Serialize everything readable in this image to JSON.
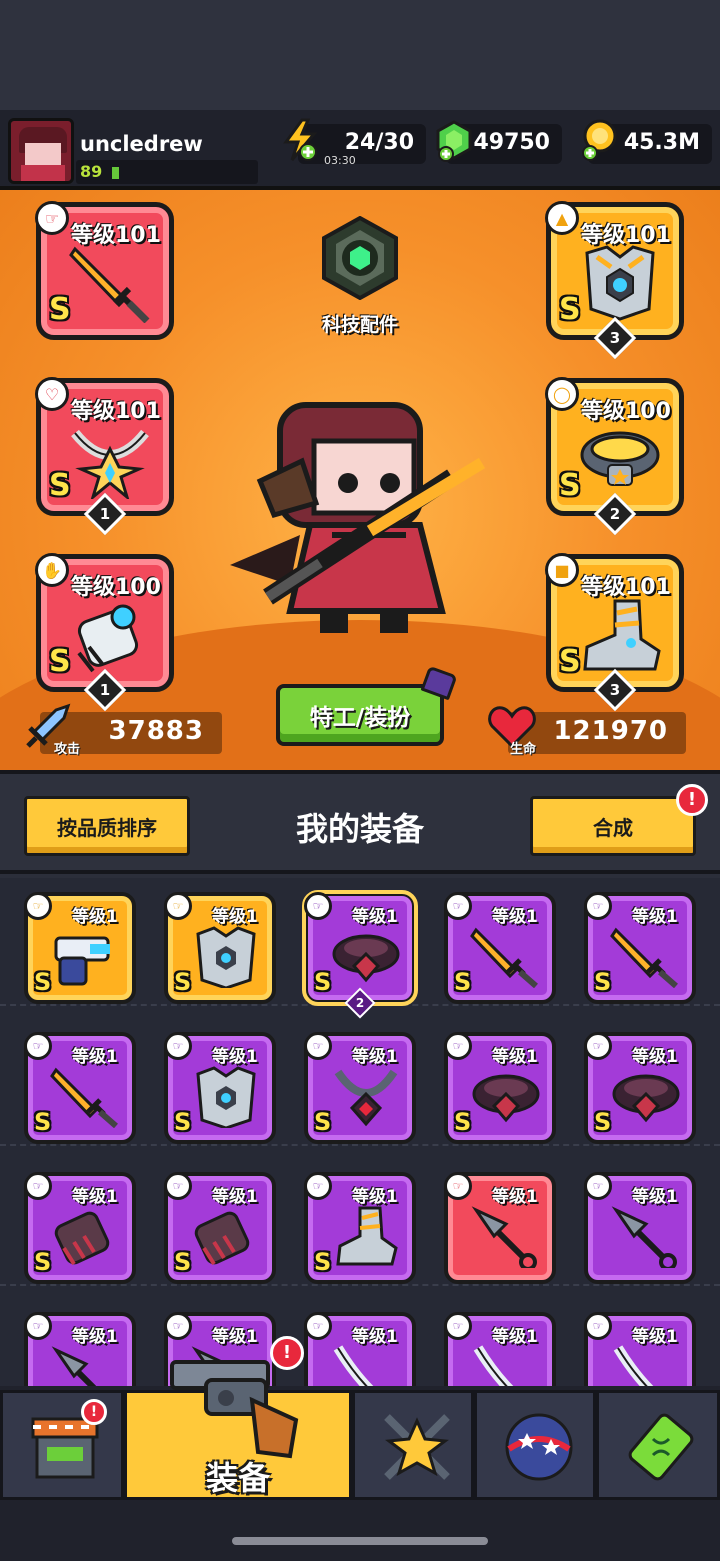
{
  "player": {
    "name": "uncledrew",
    "level": "89",
    "xp_fraction": 0.05
  },
  "resources": {
    "energy": {
      "value": "24/30",
      "timer": "03:30"
    },
    "gems": {
      "value": "49750"
    },
    "coins": {
      "value": "45.3M"
    }
  },
  "stage": {
    "tech_label": "科技配件",
    "costume_button": "特工/装扮",
    "attack": {
      "label": "攻击",
      "value": "37883"
    },
    "health": {
      "label": "生命",
      "value": "121970"
    }
  },
  "equipped": {
    "weapon": {
      "level": "等级101",
      "grade": "S",
      "stars": ""
    },
    "necklace": {
      "level": "等级101",
      "grade": "S",
      "stars": "1"
    },
    "glove": {
      "level": "等级100",
      "grade": "S",
      "stars": "1"
    },
    "armor": {
      "level": "等级101",
      "grade": "S",
      "stars": "3"
    },
    "belt": {
      "level": "等级100",
      "grade": "S",
      "stars": "2"
    },
    "boots": {
      "level": "等级101",
      "grade": "S",
      "stars": "3"
    }
  },
  "equipment_panel": {
    "sort_button": "按品质排序",
    "title": "我的装备",
    "merge_button": "合成",
    "alert": "!"
  },
  "inventory": [
    {
      "level": "等级1",
      "grade": "S",
      "rarity": "gold",
      "icon": "gun-icon",
      "stars": ""
    },
    {
      "level": "等级1",
      "grade": "S",
      "rarity": "gold",
      "icon": "armor-icon",
      "stars": ""
    },
    {
      "level": "等级1",
      "grade": "S",
      "rarity": "purple",
      "icon": "belt-icon",
      "stars": "2"
    },
    {
      "level": "等级1",
      "grade": "S",
      "rarity": "purple",
      "icon": "sword-icon",
      "stars": ""
    },
    {
      "level": "等级1",
      "grade": "S",
      "rarity": "purple",
      "icon": "sword-icon",
      "stars": ""
    },
    {
      "level": "等级1",
      "grade": "S",
      "rarity": "purple",
      "icon": "sword-icon",
      "stars": ""
    },
    {
      "level": "等级1",
      "grade": "S",
      "rarity": "purple",
      "icon": "armor-icon",
      "stars": ""
    },
    {
      "level": "等级1",
      "grade": "S",
      "rarity": "purple",
      "icon": "necklace-icon",
      "stars": ""
    },
    {
      "level": "等级1",
      "grade": "S",
      "rarity": "purple",
      "icon": "belt-icon",
      "stars": ""
    },
    {
      "level": "等级1",
      "grade": "S",
      "rarity": "purple",
      "icon": "belt-icon",
      "stars": ""
    },
    {
      "level": "等级1",
      "grade": "S",
      "rarity": "purple",
      "icon": "glove-icon",
      "stars": ""
    },
    {
      "level": "等级1",
      "grade": "S",
      "rarity": "purple",
      "icon": "glove-icon",
      "stars": ""
    },
    {
      "level": "等级1",
      "grade": "S",
      "rarity": "purple",
      "icon": "boots-icon",
      "stars": ""
    },
    {
      "level": "等级1",
      "grade": "",
      "rarity": "red",
      "icon": "kunai-icon",
      "stars": ""
    },
    {
      "level": "等级1",
      "grade": "",
      "rarity": "purple",
      "icon": "kunai-icon",
      "stars": ""
    },
    {
      "level": "等级1",
      "grade": "",
      "rarity": "purple",
      "icon": "kunai-icon",
      "stars": ""
    },
    {
      "level": "等级1",
      "grade": "",
      "rarity": "purple",
      "icon": "kunai-icon",
      "stars": ""
    },
    {
      "level": "等级1",
      "grade": "",
      "rarity": "purple",
      "icon": "blade-icon",
      "stars": ""
    },
    {
      "level": "等级1",
      "grade": "",
      "rarity": "purple",
      "icon": "blade-icon",
      "stars": ""
    },
    {
      "level": "等级1",
      "grade": "",
      "rarity": "purple",
      "icon": "blade-icon",
      "stars": ""
    }
  ],
  "nav": {
    "active_label": "装备",
    "tabs": [
      "shop-icon",
      "gun-icon",
      "star-swords-icon",
      "planet-icon",
      "capsule-icon"
    ]
  },
  "colors": {
    "stage_orange": "#f6902a",
    "purple_rarity": "#a33bd8",
    "gold_rarity": "#ffb11f",
    "red_rarity": "#f24a5c",
    "accent_yellow": "#ffc93a"
  }
}
